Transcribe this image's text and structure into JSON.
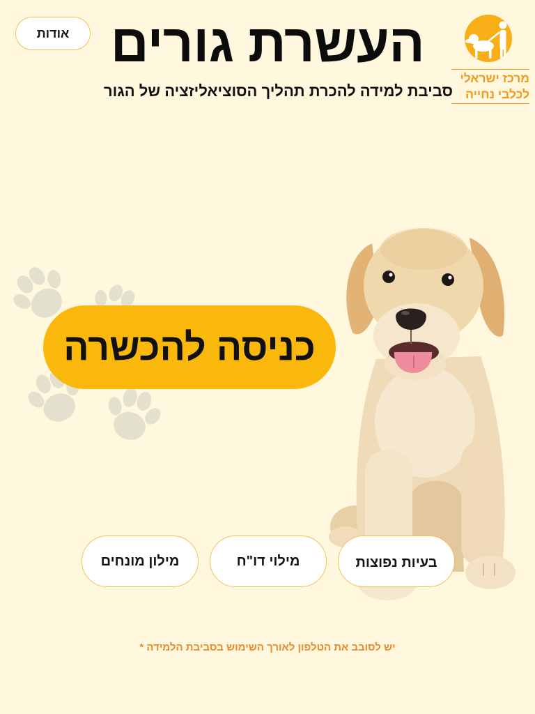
{
  "header": {
    "about_label": "אודות",
    "title": "העשרת גורים",
    "subtitle": "סביבת למידה להכרת תהליך הסוציאליזציה של הגור"
  },
  "logo": {
    "icon": "guide-dog-logo-icon",
    "line1": "מרכז ישראלי",
    "line2": "לכלבי נחייה"
  },
  "main": {
    "enter_training_label": "כניסה להכשרה",
    "illustration": "puppy-image",
    "decoration_icon": "paw-print-icon"
  },
  "nav_buttons": [
    {
      "label": "בעיות נפוצות"
    },
    {
      "label": "מילוי דו\"ח"
    },
    {
      "label": "מילון מונחים"
    }
  ],
  "footnote": "יש לסובב את הטלפון לאורך השימוש בסביבת הלמידה *",
  "colors": {
    "background": "#FFF8DF",
    "accent": "#FBB80C",
    "button_border": "#F2C24F",
    "logo_orange": "#F39A1E",
    "logo_circle": "#F8AF17",
    "footnote": "#EC8B2A",
    "paw_decoration": "#E4E0CE"
  }
}
